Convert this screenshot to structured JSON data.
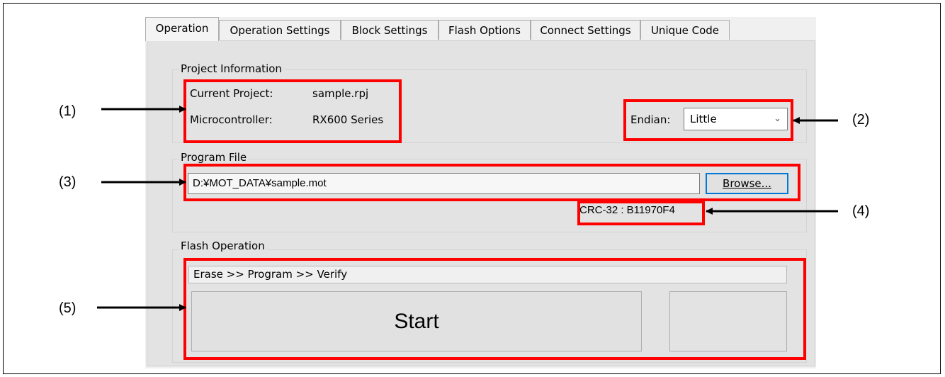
{
  "tabs": [
    {
      "label": "Operation",
      "active": true
    },
    {
      "label": "Operation Settings"
    },
    {
      "label": "Block Settings"
    },
    {
      "label": "Flash Options"
    },
    {
      "label": "Connect Settings"
    },
    {
      "label": "Unique Code"
    }
  ],
  "project_info": {
    "title": "Project Information",
    "current_project_label": "Current Project:",
    "current_project_value": "sample.rpj",
    "microcontroller_label": "Microcontroller:",
    "microcontroller_value": "RX600 Series",
    "endian_label": "Endian:",
    "endian_value": "Little"
  },
  "program_file": {
    "title": "Program File",
    "path": "D:¥MOT_DATA¥sample.mot",
    "browse_label": "Browse...",
    "crc": "CRC-32 : B11970F4"
  },
  "flash_operation": {
    "title": "Flash Operation",
    "sequence": "Erase >> Program >> Verify",
    "start_label": "Start"
  },
  "callouts": {
    "c1": "(1)",
    "c2": "(2)",
    "c3": "(3)",
    "c4": "(4)",
    "c5": "(5)"
  },
  "colors": {
    "highlight": "#ff0000",
    "focus_border": "#0078d7"
  }
}
